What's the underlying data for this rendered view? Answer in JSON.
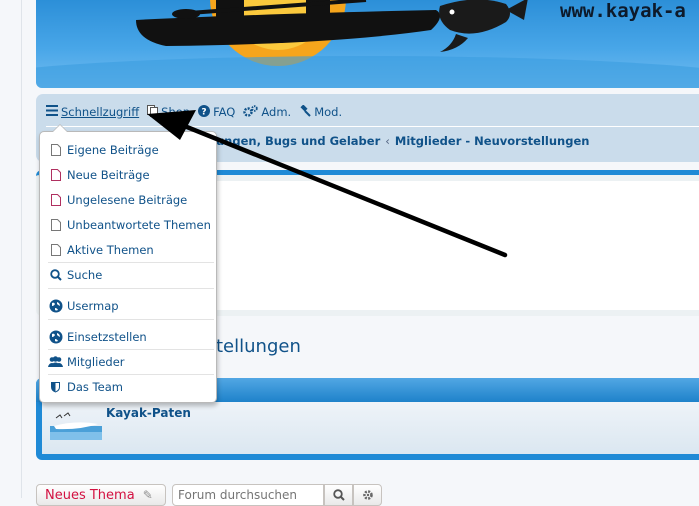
{
  "header": {
    "site_url": "www.kayak-a"
  },
  "navbar": {
    "quick_access": "Schnellzugriff",
    "shop": "Shop",
    "faq": "FAQ",
    "adm": "Adm.",
    "mod": "Mod.",
    "breadcrumbs": [
      "ungen, Bugs und Gelaber",
      "Mitglieder - Neuvorstellungen"
    ]
  },
  "quick_menu": {
    "items": [
      {
        "label": "Eigene Beiträge",
        "icon": "file-icon"
      },
      {
        "label": "Neue Beiträge",
        "icon": "file-icon"
      },
      {
        "label": "Ungelesene Beiträge",
        "icon": "file-icon"
      },
      {
        "label": "Unbeantwortete Themen",
        "icon": "file-icon"
      },
      {
        "label": "Aktive Themen",
        "icon": "file-icon"
      },
      {
        "label": "Suche",
        "icon": "search-icon"
      },
      {
        "label": "Usermap",
        "icon": "globe-icon"
      },
      {
        "label": "Einsetzstellen",
        "icon": "globe-icon"
      },
      {
        "label": "Mitglieder",
        "icon": "users-icon"
      },
      {
        "label": "Das Team",
        "icon": "shield-icon"
      }
    ]
  },
  "main": {
    "topic_title_fragment": "tellungen",
    "forum_row_name": "Kayak-Paten"
  },
  "actions": {
    "new_topic": "Neues Thema",
    "search_placeholder": "Forum durchsuchen"
  },
  "colors": {
    "link": "#105289",
    "accent_blue": "#1f8ad6",
    "nav_bg": "#cadceb",
    "new_topic_red": "#d31141"
  }
}
